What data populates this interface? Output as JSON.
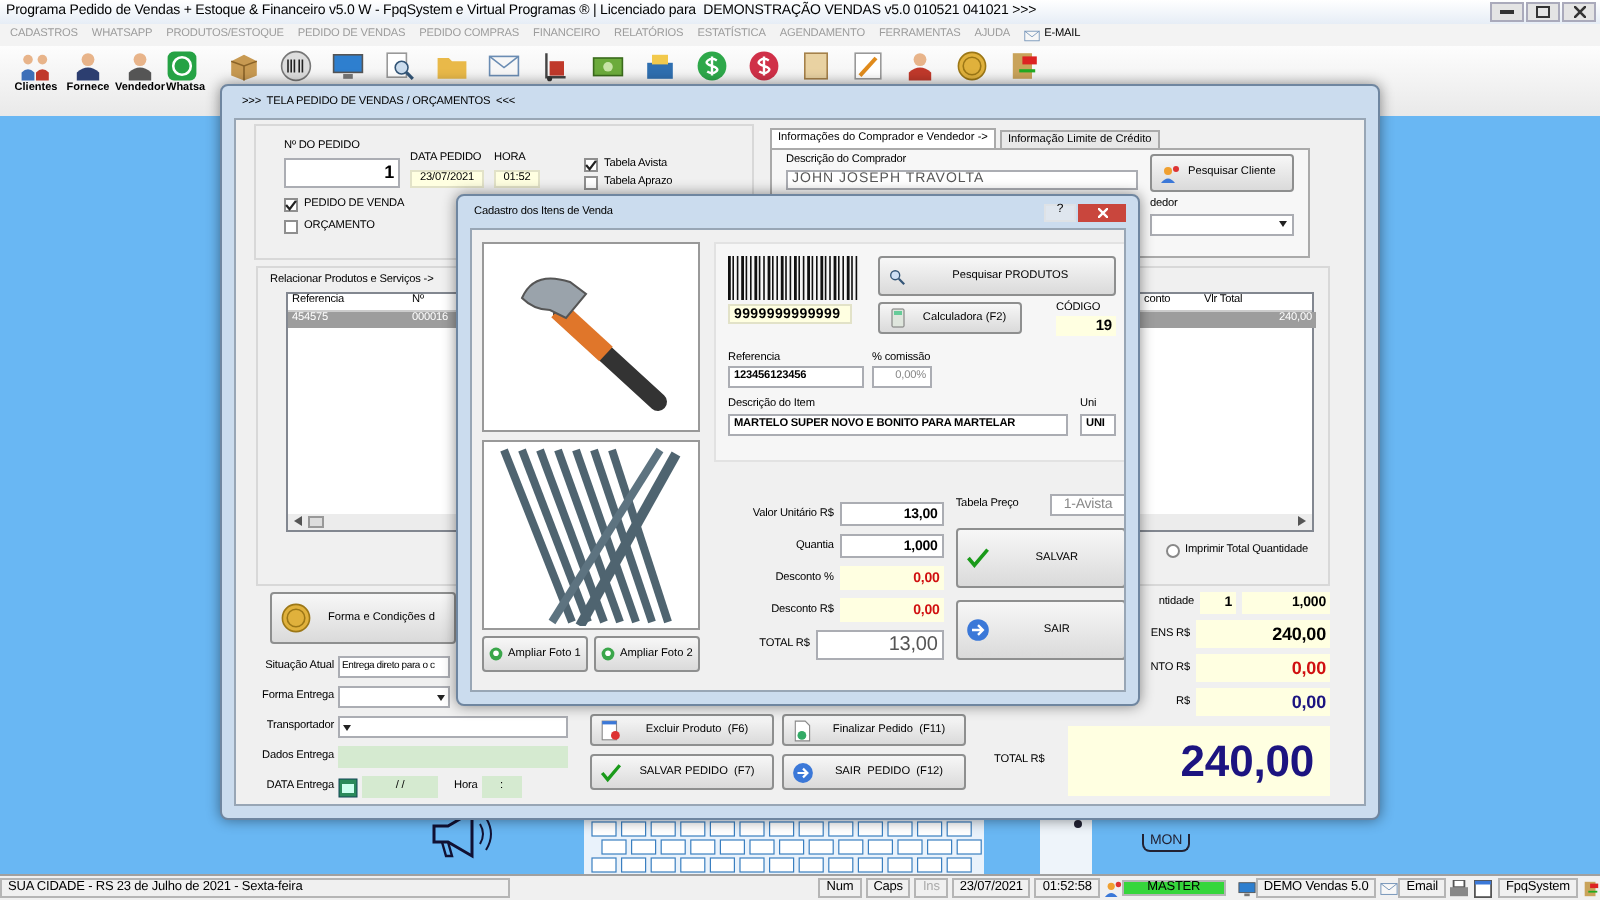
{
  "window": {
    "title": "Programa Pedido de Vendas + Estoque & Financeiro v5.0 W - FpqSystem e Virtual Programas ® | Licenciado para  DEMONSTRAÇÃO VENDAS v5.0 010521 041021 >>>"
  },
  "menu": [
    {
      "label": "CADASTROS",
      "disabled": true
    },
    {
      "label": "WHATSAPP",
      "disabled": true
    },
    {
      "label": "PRODUTOS/ESTOQUE",
      "disabled": true
    },
    {
      "label": "PEDIDO DE VENDAS",
      "disabled": true
    },
    {
      "label": "PEDIDO COMPRAS",
      "disabled": true
    },
    {
      "label": "FINANCEIRO",
      "disabled": true
    },
    {
      "label": "RELATÓRIOS",
      "disabled": true
    },
    {
      "label": "ESTATÍSTICA",
      "disabled": true
    },
    {
      "label": "AGENDAMENTO",
      "disabled": true
    },
    {
      "label": "FERRAMENTAS",
      "disabled": true
    },
    {
      "label": "AJUDA",
      "disabled": true
    },
    {
      "label": "E-MAIL",
      "disabled": false,
      "kind": "mail"
    }
  ],
  "toolbar": [
    {
      "kind": "people",
      "label": "Clientes"
    },
    {
      "kind": "person",
      "label": "Fornece"
    },
    {
      "kind": "seller",
      "label": "Vendedor"
    },
    {
      "kind": "chat",
      "label": "Whatsa"
    },
    {
      "kind": "box"
    },
    {
      "kind": "barcode"
    },
    {
      "kind": "monitor"
    },
    {
      "kind": "magnifier"
    },
    {
      "kind": "folder"
    },
    {
      "kind": "envelope"
    },
    {
      "kind": "handtruck"
    },
    {
      "kind": "banknote"
    },
    {
      "kind": "register"
    },
    {
      "kind": "greencoin"
    },
    {
      "kind": "redcoin"
    },
    {
      "kind": "scroll"
    },
    {
      "kind": "pencil"
    },
    {
      "kind": "agent"
    },
    {
      "kind": "coin"
    },
    {
      "kind": "exit"
    }
  ],
  "order_window": {
    "title": ">>>  TELA PEDIDO DE VENDAS / ORÇAMENTOS  <<<",
    "order_number": {
      "label": "Nº DO PEDIDO",
      "value": "1"
    },
    "order_date": {
      "label": "DATA PEDIDO",
      "value": "23/07/2021"
    },
    "order_time": {
      "label": "HORA",
      "value": "01:52"
    },
    "doc_type": [
      {
        "label": "PEDIDO DE VENDA",
        "checked": true
      },
      {
        "label": "ORÇAMENTO",
        "checked": false
      }
    ],
    "price_tables": [
      {
        "label": "Tabela Avista",
        "checked": true
      },
      {
        "label": "Tabela Aprazo",
        "checked": false
      }
    ],
    "buyer_tabs": [
      {
        "label": "Informações do Comprador e Vendedor ->",
        "selected": true
      },
      {
        "label": "Informação Limite de Crédito",
        "selected": false
      }
    ],
    "buyer": {
      "label": "Descrição do Comprador",
      "value": "JOHN JOSEPH TRAVOLTA"
    },
    "search_client_button": "Pesquisar Cliente",
    "seller_label": "dedor",
    "products": {
      "group_label": "Relacionar Produtos e Serviços ->",
      "columns": [
        "Referencia",
        "Nº",
        "conto",
        "Vlr Total"
      ],
      "rows": [
        {
          "selected": true,
          "reference": "454575",
          "number": "000016",
          "total": "240,00"
        }
      ]
    },
    "print_total_quantity": {
      "label": "Imprimir Total Quantidade",
      "selected": false
    },
    "payment_button": "Forma e Condições d",
    "delivery": [
      {
        "kind": "select",
        "label": "Situação Atual",
        "value": "Entrega direto para o c"
      },
      {
        "kind": "select",
        "label": "Forma Entrega"
      },
      {
        "kind": "select",
        "label": "Transportador"
      },
      {
        "kind": "text",
        "label": "Dados Entrega"
      },
      {
        "kind": "datetime",
        "label": "DATA Entrega",
        "value": "/ /",
        "time_label": "Hora",
        "time_value": ":"
      }
    ],
    "actions": [
      {
        "kind": "delete",
        "label": "Excluir Produto  (F6)"
      },
      {
        "kind": "finish",
        "label": "Finalizar Pedido  (F11)"
      },
      {
        "kind": "save",
        "label": "SALVAR PEDIDO  (F7)"
      },
      {
        "kind": "exit",
        "label": "SAIR  PEDIDO  (F12)"
      }
    ],
    "totals": [
      {
        "kind": "quantity",
        "label": "ntidade",
        "values": [
          "1",
          "1,000"
        ]
      },
      {
        "kind": "items",
        "label": "ENS R$",
        "values": [
          "240,00"
        ]
      },
      {
        "kind": "discount",
        "label": "NTO R$",
        "values": [
          "0,00"
        ]
      },
      {
        "kind": "other",
        "label": "R$",
        "values": [
          "0,00"
        ]
      },
      {
        "kind": "grand",
        "label": "TOTAL R$",
        "values": [
          "240,00"
        ]
      }
    ]
  },
  "item_dialog": {
    "title": "Cadastro dos Itens de Venda",
    "help_button": "?",
    "barcode": "9999999999999",
    "search_products_button": "Pesquisar PRODUTOS",
    "calculator_button": "Calculadora (F2)",
    "code": {
      "label": "CÓDIGO",
      "value": "19"
    },
    "reference": {
      "label": "Referencia",
      "value": "123456123456"
    },
    "commission": {
      "label": "% comissão",
      "value": "0,00%"
    },
    "description": {
      "label": "Descrição do Item",
      "value": "MARTELO SUPER NOVO E BONITO PARA MARTELAR"
    },
    "unit": {
      "label": "Uni",
      "value": "UNI"
    },
    "photo_buttons": [
      "Ampliar Foto 1",
      "Ampliar Foto 2"
    ],
    "amounts": [
      {
        "kind": "plain",
        "label": "Valor Unitário R$",
        "value": "13,00"
      },
      {
        "kind": "plain",
        "label": "Quantia",
        "value": "1,000"
      },
      {
        "kind": "discount",
        "label": "Desconto %",
        "value": "0,00"
      },
      {
        "kind": "discount",
        "label": "Desconto R$",
        "value": "0,00"
      },
      {
        "kind": "total",
        "label": "TOTAL R$",
        "value": "13,00"
      }
    ],
    "price_table": {
      "label": "Tabela Preço",
      "value": "1-Avista"
    },
    "save_button": "SALVAR",
    "exit_button": "SAIR"
  },
  "desktop": {
    "sign": "MON"
  },
  "status_bar": {
    "location": "SUA CIDADE - RS 23 de Julho de 2021 - Sexta-feira",
    "indicators": [
      {
        "label": "Num",
        "disabled": false
      },
      {
        "label": "Caps",
        "disabled": false
      },
      {
        "label": "Ins",
        "disabled": true
      }
    ],
    "date": "23/07/2021",
    "time": "01:52:58",
    "user": "MASTER",
    "product": "DEMO Vendas 5.0",
    "email": "Email",
    "company": "FpqSystem"
  }
}
